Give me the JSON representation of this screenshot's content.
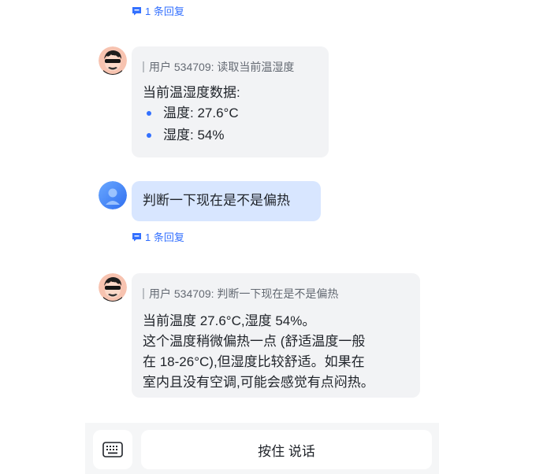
{
  "reply_link_1": {
    "text": "1 条回复"
  },
  "msg1": {
    "quote": "用户 534709: 读取当前温湿度",
    "heading": "当前温湿度数据:",
    "items": [
      "温度: 27.6°C",
      "湿度: 54%"
    ]
  },
  "msg2": {
    "text": "判断一下现在是不是偏热"
  },
  "reply_link_2": {
    "text": "1 条回复"
  },
  "msg3": {
    "quote": "用户 534709: 判断一下现在是不是偏热",
    "lines": [
      "当前温度 27.6°C,湿度 54%。",
      "这个温度稍微偏热一点 (舒适温度一般",
      "在 18-26°C),但湿度比较舒适。如果在",
      "室内且没有空调,可能会感觉有点闷热。"
    ]
  },
  "composer": {
    "keyboard_icon": "keyboard-icon",
    "talk_label": "按住 说话"
  },
  "colors": {
    "accent": "#3370ff",
    "bubble_grey": "#f2f3f5",
    "bubble_blue": "#d8e6ff"
  }
}
